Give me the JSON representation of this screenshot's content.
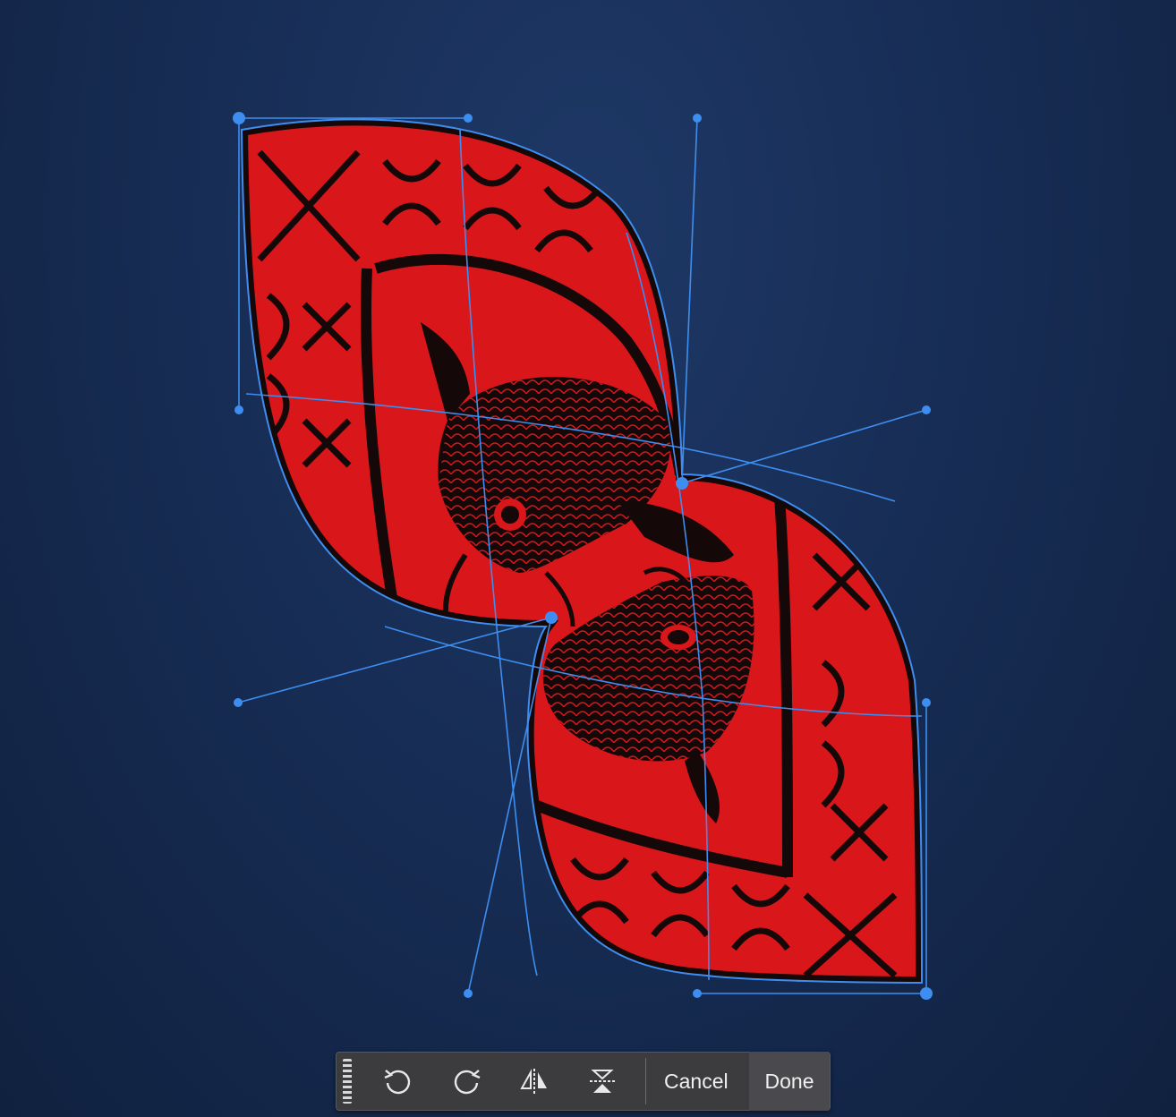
{
  "toolbar": {
    "grip_icon": "drag-grip-icon",
    "rotate_left_icon": "rotate-counterclockwise-icon",
    "rotate_right_icon": "rotate-clockwise-icon",
    "flip_horizontal_icon": "flip-horizontal-icon",
    "flip_vertical_icon": "flip-vertical-icon",
    "cancel_label": "Cancel",
    "done_label": "Done"
  },
  "colors": {
    "canvas_background": "#172d55",
    "artwork_red": "#d9161a",
    "artwork_black": "#140808",
    "handle_blue": "#3d8ef0",
    "toolbar_background": "#3c3c3f"
  }
}
